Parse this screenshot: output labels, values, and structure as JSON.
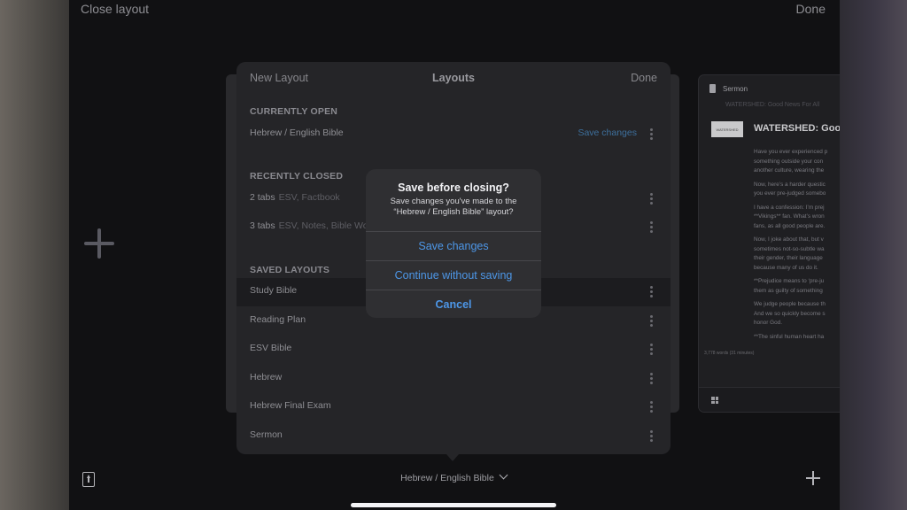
{
  "topbar": {
    "close_label": "Close layout",
    "done_label": "Done"
  },
  "panel": {
    "new_label": "New Layout",
    "title": "Layouts",
    "done_label": "Done",
    "currently_open": {
      "heading": "CURRENTLY OPEN",
      "items": [
        {
          "label": "Hebrew / English Bible",
          "action": "Save changes"
        }
      ]
    },
    "recently_closed": {
      "heading": "RECENTLY CLOSED",
      "items": [
        {
          "label": "2 tabs",
          "sub": "ESV, Factbook"
        },
        {
          "label": "3 tabs",
          "sub": "ESV, Notes, Bible Word"
        }
      ]
    },
    "saved_layouts": {
      "heading": "SAVED LAYOUTS",
      "items": [
        {
          "label": "Study Bible"
        },
        {
          "label": "Reading Plan"
        },
        {
          "label": "ESV Bible"
        },
        {
          "label": "Hebrew"
        },
        {
          "label": "Hebrew Final Exam"
        },
        {
          "label": "Sermon"
        }
      ]
    }
  },
  "dialog": {
    "title": "Save before closing?",
    "message_line1": "Save changes you've made to the",
    "message_line2": "“Hebrew / English Bible” layout?",
    "save_label": "Save changes",
    "continue_label": "Continue without saving",
    "cancel_label": "Cancel"
  },
  "sermon_card": {
    "header": "Sermon",
    "subtitle": "WATERSHED: Good News For All",
    "thumb_text": "WATERSHED",
    "title": "WATERSHED: Good",
    "paragraphs": [
      [
        "Have you ever experienced p",
        "something outside your con",
        "another culture, wearing the"
      ],
      [
        "Now, here’s a harder questic",
        "you ever pre-judged somebo"
      ],
      [
        "I have a confession: I’m prej",
        "**Vikings** fan. What’s wron",
        "fans, as all good people are."
      ],
      [
        "Now, I joke about that, but v",
        "sometimes not-so-subtle wa",
        "their gender, their language",
        "because many of us do it."
      ],
      [
        "**Prejudice means to ‘pre-ju",
        "them as guilty of something"
      ],
      [
        "We judge people because th",
        "And we so quickly become s",
        "honor God."
      ],
      [
        "**The sinful human heart ha"
      ]
    ],
    "words_label": "3,778 words (31 minutes)"
  },
  "bottom": {
    "layout_title": "Hebrew / English Bible"
  },
  "colors": {
    "accent": "#4d97e8",
    "panel_bg": "#252528",
    "dialog_bg": "#2f2f32"
  }
}
